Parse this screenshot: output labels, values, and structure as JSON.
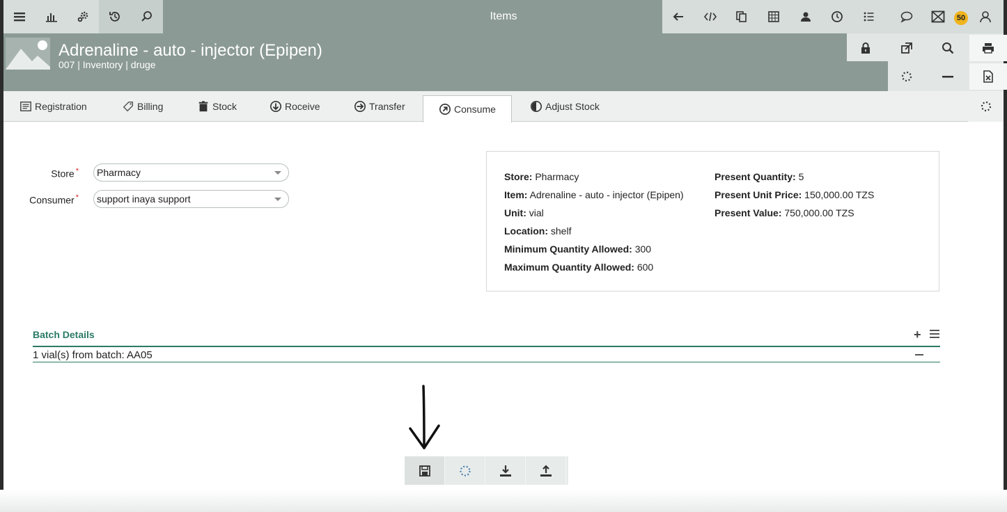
{
  "app": {
    "title": "Items",
    "notification_count": "50"
  },
  "item": {
    "title": "Adrenaline - auto - injector (Epipen)",
    "subtitle": "007 | Inventory | druge"
  },
  "tabs": [
    {
      "label": "Registration",
      "icon": "registration-icon"
    },
    {
      "label": "Billing",
      "icon": "tag-icon"
    },
    {
      "label": "Stock",
      "icon": "trash-icon"
    },
    {
      "label": "Roceive",
      "icon": "arrow-down-circle-icon"
    },
    {
      "label": "Transfer",
      "icon": "arrow-right-circle-icon"
    },
    {
      "label": "Consume",
      "icon": "arrow-up-right-circle-icon",
      "active": true
    },
    {
      "label": "Adjust Stock",
      "icon": "half-circle-icon"
    }
  ],
  "form": {
    "store_label": "Store",
    "store_value": "Pharmacy",
    "consumer_label": "Consumer",
    "consumer_value": "support inaya support",
    "required_mark": "*"
  },
  "info": {
    "store_label": "Store:",
    "store_value": "Pharmacy",
    "item_label": "Item:",
    "item_value": "Adrenaline - auto - injector (Epipen)",
    "unit_label": "Unit:",
    "unit_value": "vial",
    "location_label": "Location:",
    "location_value": "shelf",
    "min_label": "Minimum Quantity Allowed:",
    "min_value": "300",
    "max_label": "Maximum Quantity Allowed:",
    "max_value": "600",
    "present_qty_label": "Present Quantity:",
    "present_qty_value": "5",
    "present_price_label": "Present Unit Price:",
    "present_price_value": "150,000.00 TZS",
    "present_value_label": "Present Value:",
    "present_value_value": "750,000.00 TZS"
  },
  "batch": {
    "title": "Batch Details",
    "rows": [
      "1 vial(s) from batch: AA05"
    ],
    "add_symbol": "+"
  },
  "colors": {
    "header": "#8b9a95",
    "accent": "#2a7a66",
    "badge": "#f0b41c"
  }
}
